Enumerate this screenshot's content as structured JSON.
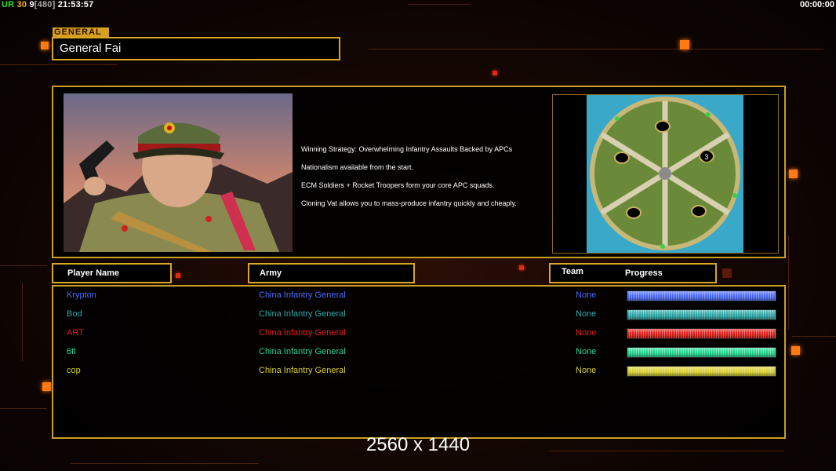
{
  "hud": {
    "ur": "UR",
    "fps": "30",
    "num": "9",
    "bracket": "[480]",
    "clock": "21:53:57",
    "timer": "00:00:00"
  },
  "general": {
    "section_label": "GENERAL",
    "name": "General Fai"
  },
  "description": [
    "Winning Strategy: Overwhelming Infantry Assaults Backed by APCs",
    "Nationalism available from the start.",
    "ECM Soldiers + Rocket Troopers form your core APC squads.",
    "Cloning Vat allows you to mass-produce infantry quickly and cheaply."
  ],
  "map": {
    "player_slot": "3"
  },
  "headers": {
    "player_name": "Player Name",
    "army": "Army",
    "team": "Team",
    "progress": "Progress"
  },
  "players": [
    {
      "name": "Krypton",
      "army": "China Infantry General",
      "team": "None",
      "color": "#4a6cff"
    },
    {
      "name": "Bod",
      "army": "China Infantry General",
      "team": "None",
      "color": "#2aa8a8"
    },
    {
      "name": "ART",
      "army": "China Infantry General",
      "team": "None",
      "color": "#e0201a"
    },
    {
      "name": "6tl",
      "army": "China Infantry General",
      "team": "None",
      "color": "#22d890"
    },
    {
      "name": "cop",
      "army": "China Infantry General",
      "team": "None",
      "color": "#d8d030"
    }
  ],
  "watermark": "2560 x 1440"
}
